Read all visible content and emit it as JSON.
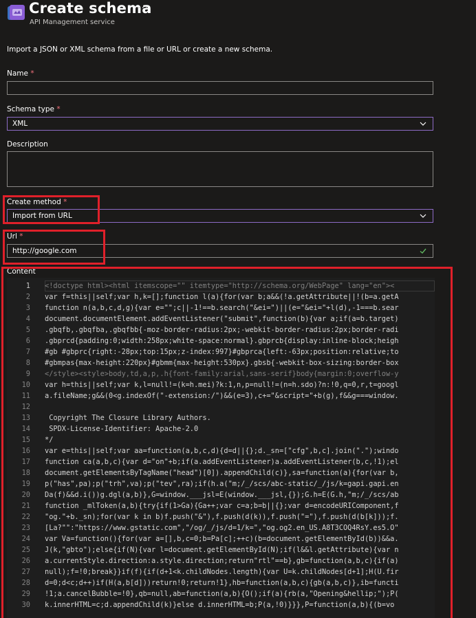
{
  "header": {
    "title": "Create schema",
    "more": "···",
    "subtitle": "API Management service"
  },
  "intro": "Import a JSON or XML schema from a file or URL or create a new schema.",
  "form": {
    "name": {
      "label": "Name",
      "required": "*",
      "value": ""
    },
    "schema_type": {
      "label": "Schema type",
      "required": "*",
      "value": "XML"
    },
    "description": {
      "label": "Description",
      "value": ""
    },
    "create_method": {
      "label": "Create method",
      "required": "*",
      "value": "Import from URL"
    },
    "url": {
      "label": "Url",
      "required": "*",
      "value": "http://google.com"
    },
    "content": {
      "label": "Content"
    }
  },
  "editor": {
    "line_numbers": [
      "1",
      "2",
      "3",
      "4",
      "5",
      "6",
      "7",
      "8",
      "9",
      "10",
      "11",
      "12",
      "13",
      "14",
      "15",
      "16",
      "17",
      "18",
      "19",
      "20",
      "21",
      "22",
      "23",
      "24",
      "25",
      "26",
      "27",
      "28",
      "29",
      "30"
    ],
    "lines": [
      "<!doctype html><html itemscope=\"\" itemtype=\"http://schema.org/WebPage\" lang=\"en\"><",
      "var f=this||self;var h,k=[];function l(a){for(var b;a&&(!a.getAttribute||!(b=a.getA",
      "function n(a,b,c,d,g){var e=\"\";c||-1!==b.search(\"&ei=\")||(e=\"&ei=\"+l(d),-1===b.sear",
      "document.documentElement.addEventListener(\"submit\",function(b){var a;if(a=b.target)",
      ".gbqfb,.gbqfba,.gbqfbb{-moz-border-radius:2px;-webkit-border-radius:2px;border-radi",
      ".gbprcd{padding:0;width:258px;white-space:normal}.gbprcb{display:inline-block;heigh",
      "#gb #gbprc{right:-28px;top:15px;z-index:997}#gbprca{left:-63px;position:relative;to",
      "#gbmpas{max-height:220px}#gbmm{max-height:530px}.gbsb{-webkit-box-sizing:border-box",
      "</style><style>body,td,a,p,.h{font-family:arial,sans-serif}body{margin:0;overflow-y",
      "var h=this||self;var k,l=null!=(k=h.mei)?k:1,n,p=null!=(n=h.sdo)?n:!0,q=0,r,t=googl",
      "a.fileName;g&&(0<g.indexOf(\"-extension:/\")&&(e=3),c+=\"&script=\"+b(g),f&&g===window.",
      "",
      " Copyright The Closure Library Authors.",
      " SPDX-License-Identifier: Apache-2.0",
      "*/",
      "var e=this||self;var aa=function(a,b,c,d){d=d||{};d._sn=[\"cfg\",b,c].join(\".\");windo",
      "function ca(a,b,c){var d=\"on\"+b;if(a.addEventListener)a.addEventListener(b,c,!1);el",
      "document.getElementsByTagName(\"head\")[0]).appendChild(c)},sa=function(a){for(var b,",
      "p(\"has\",pa);p(\"trh\",va);p(\"tev\",ra);if(h.a(\"m;/_/scs/abc-static/_/js/k=gapi.gapi.en",
      "Da(f)&&d.i())g.dgl(a,b)},G=window.___jsl=E(window.___jsl,{});G.h=E(G.h,\"m;/_/scs/ab",
      "function _mlToken(a,b){try{if(1>Ga){Ga++;var c=a;b=b||{};var d=encodeURIComponent,f",
      "\"og.\"+b._sn);for(var k in b)f.push(\"&\"),f.push(d(k)),f.push(\"=\"),f.push(d(b[k]));f.",
      "[La?\"\":\"https://www.gstatic.com\",\"/og/_/js/d=1/k=\",\"og.og2.en_US.A8T3COQ4RsY.es5.O\"",
      "var Va=function(){for(var a=[],b,c=0;b=Pa[c];++c)(b=document.getElementById(b))&&a.",
      "J(k,\"gbto\");else{if(N){var l=document.getElementById(N);if(l&&l.getAttribute){var n",
      "a.currentStyle.direction:a.style.direction;return\"rtl\"==b},gb=function(a,b,c){if(a)",
      "null);f=!0;break}}if(f){if(d+1<k.childNodes.length){var U=k.childNodes[d+1];H(U.fir",
      "d=0;d<c;d++)if(H(a,b[d]))return!0;return!1},hb=function(a,b,c){gb(a,b,c)},ib=functi",
      "!1;a.cancelBubble=!0},qb=null,ab=function(a,b){O();if(a){rb(a,\"Opening&hellip;\");P(",
      "k.innerHTML=c;d.appendChild(k)}else d.innerHTML=b;P(a,!0)}}},P=function(a,b){(b=vo"
    ]
  },
  "colors": {
    "background": "#1b1a19",
    "accent_border": "#8e6cc7",
    "highlight": "#e0202a",
    "required": "#f1707b",
    "check": "#5fb35f"
  },
  "icons": {
    "service": "api-management-icon",
    "chevron": "chevron-down-icon",
    "valid": "checkmark-icon"
  }
}
